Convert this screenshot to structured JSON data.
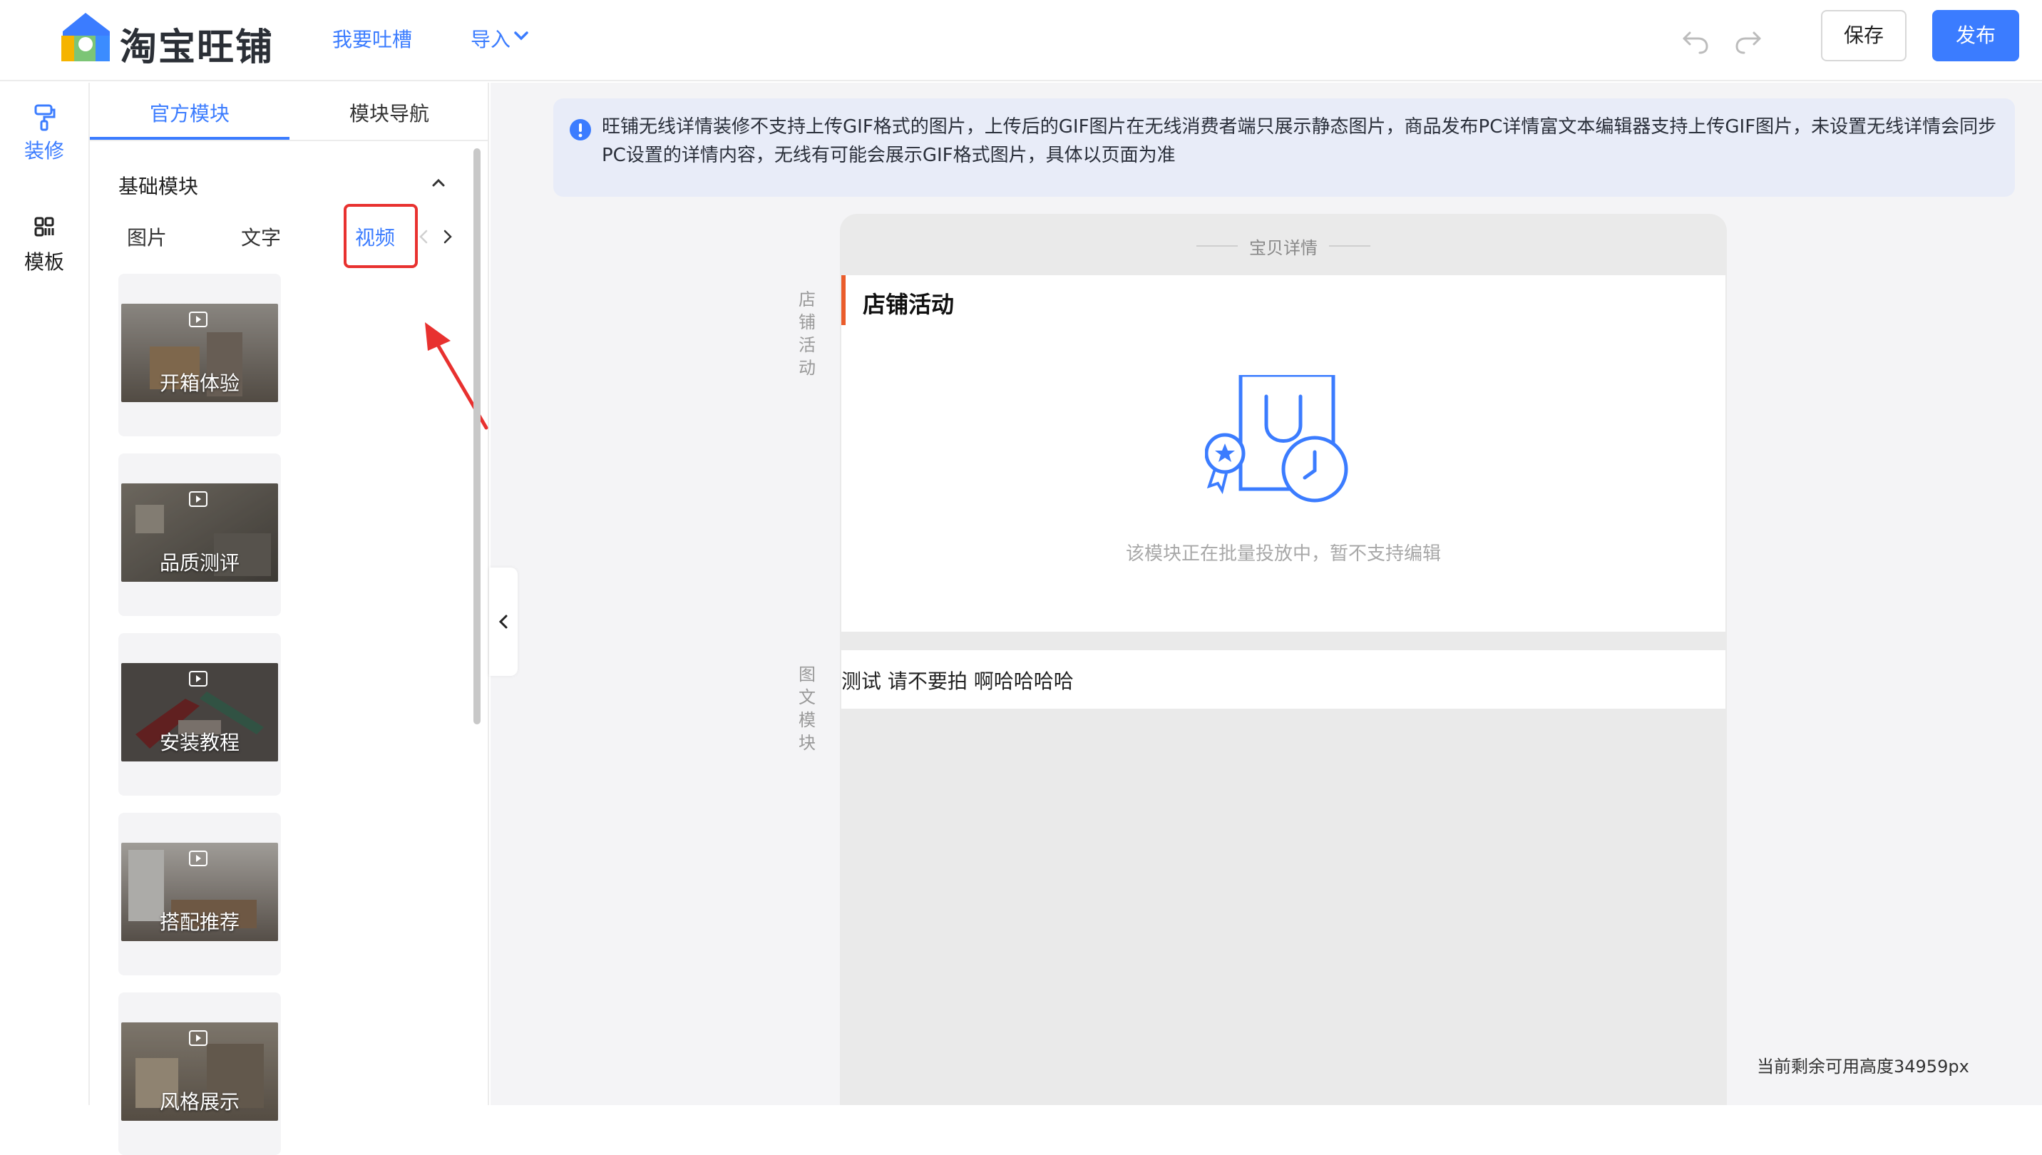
{
  "header": {
    "brand": "淘宝旺铺",
    "tucao_label": "我要吐槽",
    "import_label": "导入",
    "save_label": "保存",
    "publish_label": "发布"
  },
  "rail": {
    "items": [
      {
        "label": "装修",
        "icon": "paint-roller-icon",
        "active": true
      },
      {
        "label": "模板",
        "icon": "grid-icon",
        "active": false
      }
    ]
  },
  "panel": {
    "tabs": [
      {
        "label": "官方模块",
        "active": true
      },
      {
        "label": "模块导航",
        "active": false
      }
    ],
    "section_title": "基础模块",
    "categories": [
      {
        "label": "图片",
        "active": false
      },
      {
        "label": "文字",
        "active": false
      },
      {
        "label": "视频",
        "active": true
      }
    ],
    "videos": [
      {
        "title": "开箱体验"
      },
      {
        "title": "品质测评"
      },
      {
        "title": "安装教程"
      },
      {
        "title": "搭配推荐"
      },
      {
        "title": "风格展示"
      }
    ]
  },
  "notice": {
    "text": "旺铺无线详情装修不支持上传GIF格式的图片，上传后的GIF图片在无线消费者端只展示静态图片，商品发布PC详情富文本编辑器支持上传GIF图片，未设置无线详情会同步PC设置的详情内容，无线有可能会展示GIF格式图片，具体以页面为准"
  },
  "canvas": {
    "header": "宝贝详情",
    "shop_side_label": "店铺活动",
    "shop_module_title": "店铺活动",
    "shop_module_hint": "该模块正在批量投放中，暂不支持编辑",
    "graphic_side_label": "图文模块",
    "graphic_module_text": "测试 请不要拍 啊哈哈哈哈",
    "remaining_height": "当前剩余可用高度34959px"
  },
  "colors": {
    "accent": "#3b7cff",
    "highlight": "#e8312f",
    "shop_accent": "#ea5c2b",
    "notice_bg": "#e8ecf8"
  }
}
